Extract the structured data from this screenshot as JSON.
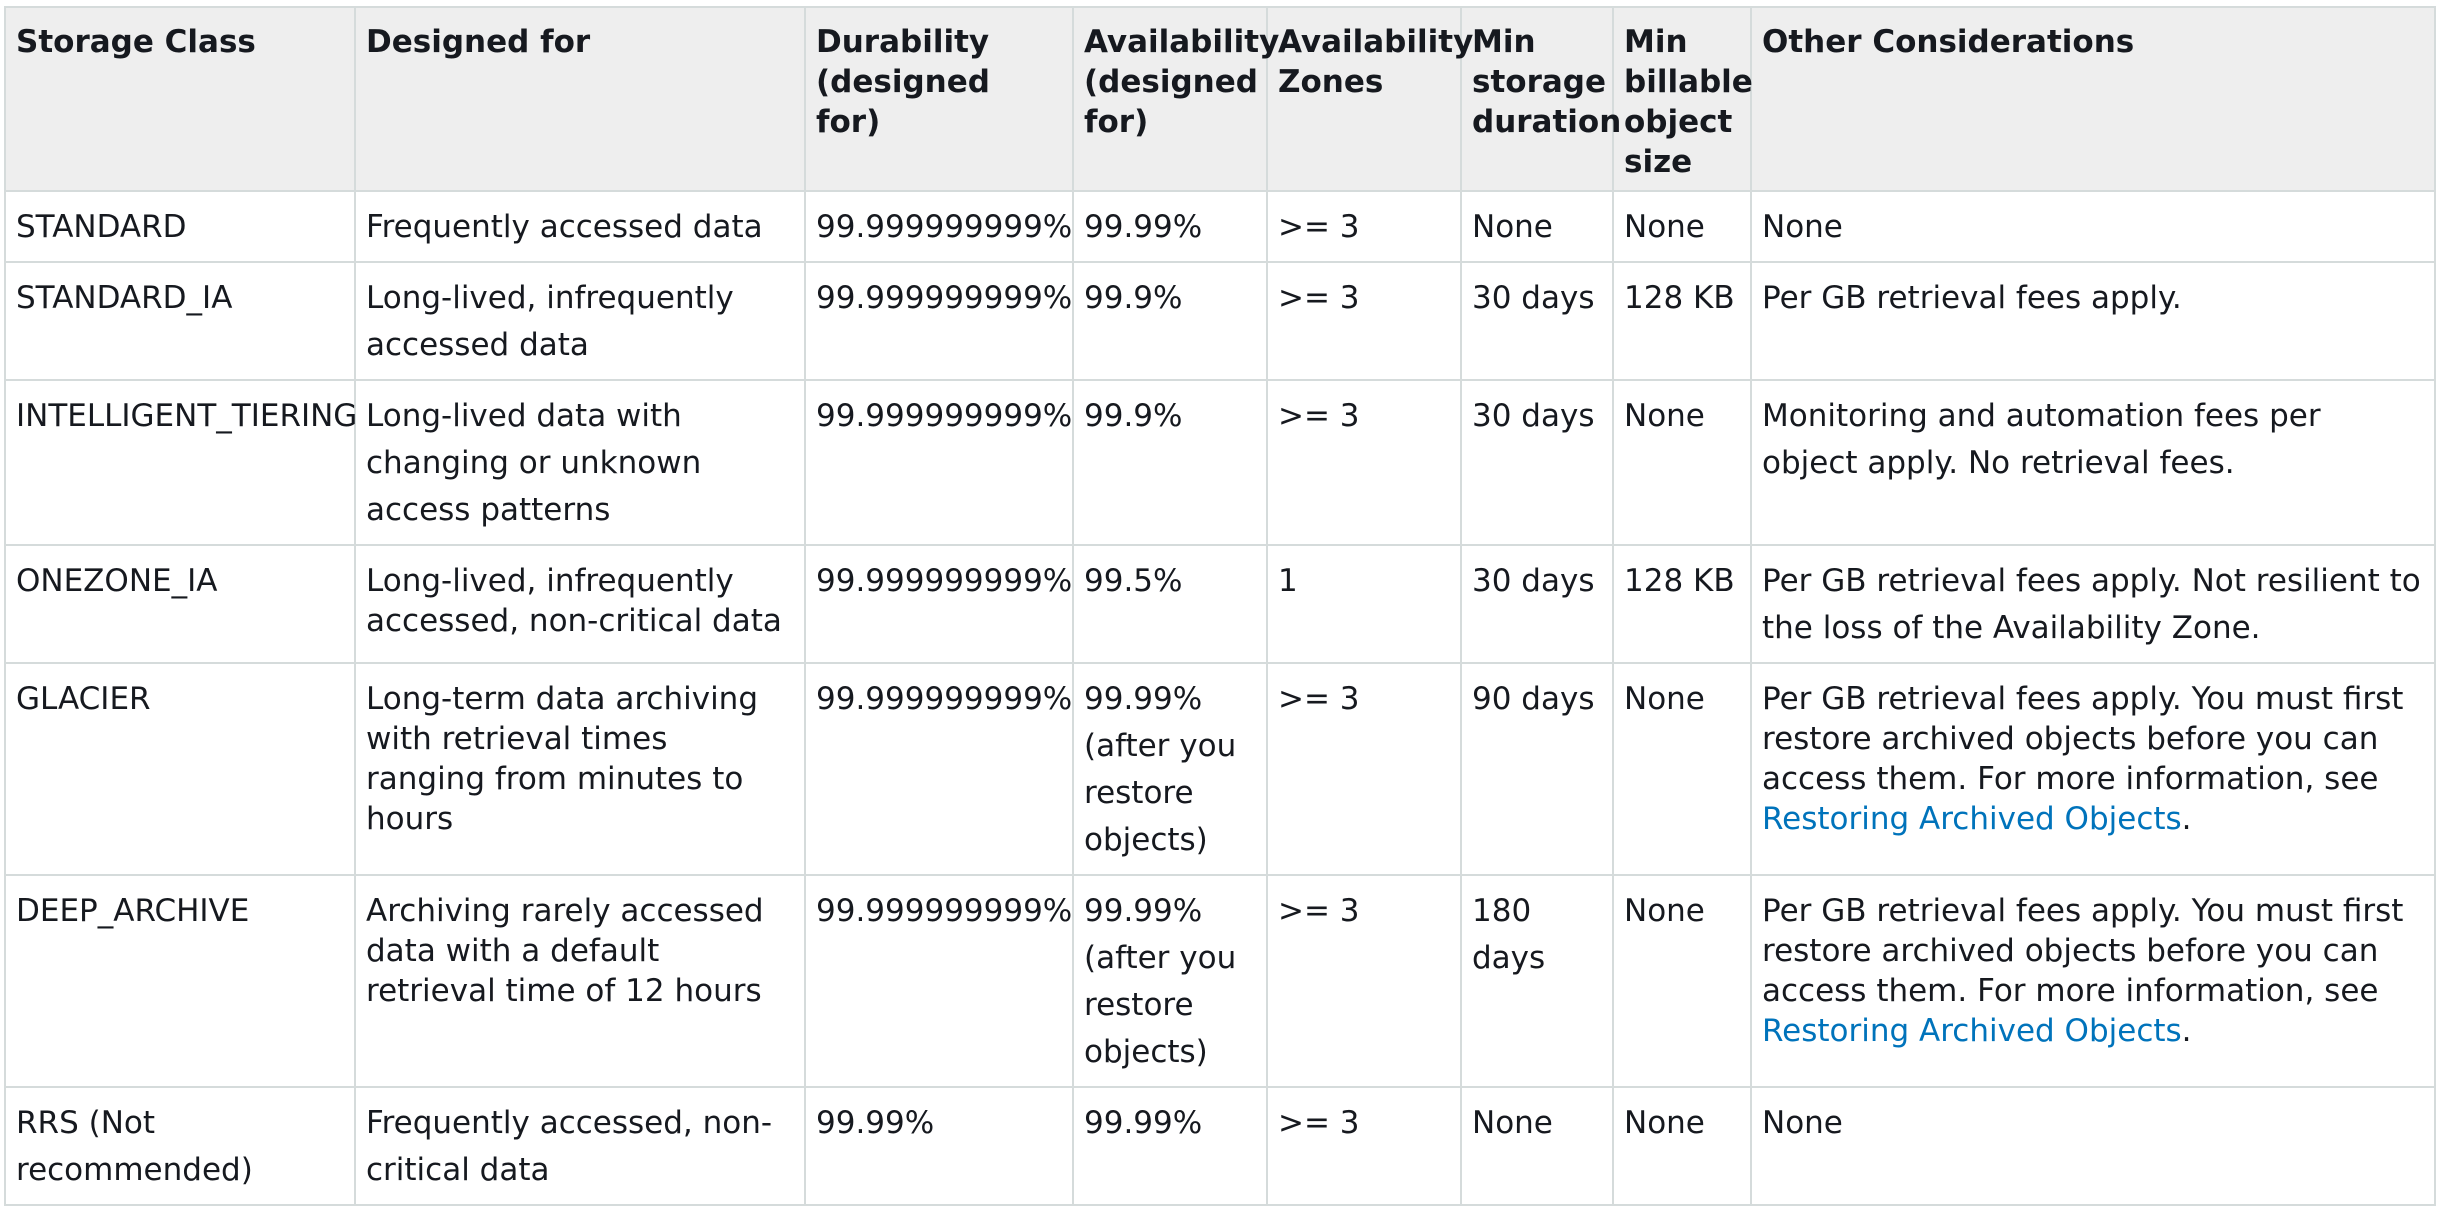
{
  "colors": {
    "header_background": "#eeeeee",
    "border": "#d5dbdb",
    "text": "#16191f",
    "link": "#0073bb"
  },
  "table": {
    "headers": {
      "storage_class": "Storage Class",
      "designed_for": "Designed for",
      "durability": "Durability (designed for)",
      "availability": "Availability (designed for)",
      "availability_zones": "Availability Zones",
      "min_storage_duration": "Min storage duration",
      "min_billable_object_size": "Min billable object size",
      "other_considerations": "Other Considerations"
    },
    "rows": [
      {
        "storage_class": "STANDARD",
        "designed_for": "Frequently accessed data",
        "durability": "99.999999999%",
        "availability": "99.99%",
        "availability_zones": ">= 3",
        "min_storage_duration": "None",
        "min_billable_object_size": "None",
        "other_considerations": "None"
      },
      {
        "storage_class": "STANDARD_IA",
        "designed_for": "Long-lived, infrequently accessed data",
        "durability": "99.999999999%",
        "availability": "99.9%",
        "availability_zones": ">= 3",
        "min_storage_duration": "30 days",
        "min_billable_object_size": "128 KB",
        "other_considerations": "Per GB retrieval fees apply."
      },
      {
        "storage_class": "INTELLIGENT_TIERING",
        "designed_for": "Long-lived data with changing or unknown access patterns",
        "durability": "99.999999999%",
        "availability": "99.9%",
        "availability_zones": ">= 3",
        "min_storage_duration": "30 days",
        "min_billable_object_size": "None",
        "other_considerations": "Monitoring and automation fees per object apply. No retrieval fees."
      },
      {
        "storage_class": "ONEZONE_IA",
        "designed_for": "Long-lived, infrequently accessed, non-critical data",
        "durability": "99.999999999%",
        "availability": "99.5%",
        "availability_zones": "1",
        "min_storage_duration": "30 days",
        "min_billable_object_size": "128 KB",
        "other_considerations": "Per GB retrieval fees apply. Not resilient to the loss of the Availability Zone."
      },
      {
        "storage_class": "GLACIER",
        "designed_for": "Long-term data archiving with retrieval times ranging from minutes to hours",
        "durability": "99.999999999%",
        "availability": "99.99% (after you restore objects)",
        "availability_zones": ">= 3",
        "min_storage_duration": "90 days",
        "min_billable_object_size": "None",
        "other_considerations": "Per GB retrieval fees apply. You must first restore archived objects before you can access them. For more information, see",
        "other_link": "Restoring Archived Objects",
        "other_suffix": "."
      },
      {
        "storage_class": "DEEP_ARCHIVE",
        "designed_for": "Archiving rarely accessed data with a default retrieval time of 12 hours",
        "durability": "99.999999999%",
        "availability": "99.99% (after you restore objects)",
        "availability_zones": ">= 3",
        "min_storage_duration": "180 days",
        "min_billable_object_size": "None",
        "other_considerations": "Per GB retrieval fees apply. You must first restore archived objects before you can access them. For more information, see",
        "other_link": "Restoring Archived Objects",
        "other_suffix": "."
      },
      {
        "storage_class": "RRS (Not recommended)",
        "designed_for": "Frequently accessed, non-critical data",
        "durability": "99.99%",
        "availability": "99.99%",
        "availability_zones": ">= 3",
        "min_storage_duration": "None",
        "min_billable_object_size": "None",
        "other_considerations": "None"
      }
    ]
  }
}
